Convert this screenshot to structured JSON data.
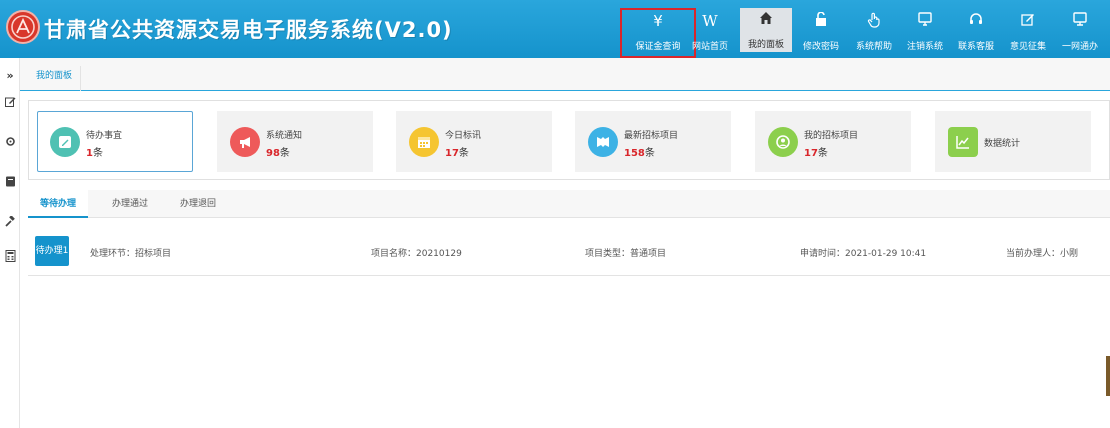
{
  "app": {
    "title": "甘肃省公共资源交易电子服务系统(V2.0)"
  },
  "nav": [
    {
      "label": "保证金查询",
      "icon": "yen-icon"
    },
    {
      "label": "网站首页",
      "icon": "w-icon"
    },
    {
      "label": "我的面板",
      "icon": "home-icon"
    },
    {
      "label": "修改密码",
      "icon": "unlock-icon"
    },
    {
      "label": "系统帮助",
      "icon": "hand-pointer-icon"
    },
    {
      "label": "注销系统",
      "icon": "monitor-icon"
    },
    {
      "label": "联系客服",
      "icon": "headset-icon"
    },
    {
      "label": "意见征集",
      "icon": "edit-icon"
    },
    {
      "label": "一网通办",
      "icon": "desktop-icon"
    }
  ],
  "rail_toggle": "»",
  "breadcrumb": {
    "current_tab": "我的面板"
  },
  "cards": [
    {
      "title": "待办事宜",
      "count": "1",
      "unit": "条",
      "color": "#4fc1b3"
    },
    {
      "title": "系统通知",
      "count": "98",
      "unit": "条",
      "color": "#ee5a5a"
    },
    {
      "title": "今日标讯",
      "count": "17",
      "unit": "条",
      "color": "#f5c531"
    },
    {
      "title": "最新招标项目",
      "count": "158",
      "unit": "条",
      "color": "#3db2e5"
    },
    {
      "title": "我的招标项目",
      "count": "17",
      "unit": "条",
      "color": "#8ccf4d"
    },
    {
      "title": "数据统计",
      "count": "",
      "unit": "",
      "color": "#8ccf4d"
    }
  ],
  "work_tabs": [
    "等待办理",
    "办理通过",
    "办理退回"
  ],
  "task": {
    "badge": "待办理1",
    "step": "处理环节：招标项目",
    "project_name": "项目名称：20210129",
    "project_type": "项目类型：普通项目",
    "apply_time": "申请时间：2021-01-29 10:41",
    "handler": "当前办理人：小刚"
  },
  "colors": {
    "header": "#1b9ad3",
    "accent": "#1593cc",
    "highlight": "#d9262b"
  }
}
